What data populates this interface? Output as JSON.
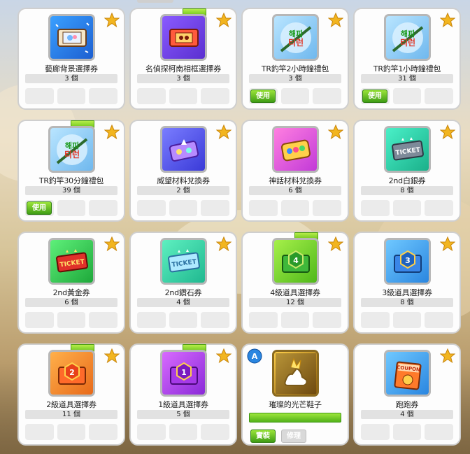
{
  "star_color": "#f2b51f",
  "use_color": "#4cae1c",
  "items": [
    {
      "name": "藝廊背景選擇券",
      "qty": "3 個",
      "icon": "ticket-photo-icon",
      "tag": false,
      "use": false
    },
    {
      "name": "名偵探柯南相框選擇券",
      "qty": "3 個",
      "icon": "ticket-frame-icon",
      "tag": true,
      "use": false
    },
    {
      "name": "TR釣竿2小時鐘禮包",
      "qty": "3 個",
      "icon": "fishing-rod-icon",
      "tag": false,
      "use": true
    },
    {
      "name": "TR釣竿1小時鐘禮包",
      "qty": "31 個",
      "icon": "fishing-rod-icon",
      "tag": false,
      "use": true
    },
    {
      "name": "TR釣竿30分鐘禮包",
      "qty": "39 個",
      "icon": "fishing-rod-icon",
      "tag": true,
      "use": true
    },
    {
      "name": "威望材料兌換券",
      "qty": "2 個",
      "icon": "material-ticket-icon",
      "tag": false,
      "use": false
    },
    {
      "name": "神話材料兌換券",
      "qty": "6 個",
      "icon": "material-ticket-icon",
      "tag": false,
      "use": false
    },
    {
      "name": "2nd白銀券",
      "qty": "8 個",
      "icon": "silver-ticket-icon",
      "tag": false,
      "use": false
    },
    {
      "name": "2nd黃金券",
      "qty": "6 個",
      "icon": "gold-ticket-icon",
      "tag": false,
      "use": false
    },
    {
      "name": "2nd鑽石券",
      "qty": "4 個",
      "icon": "diamond-ticket-icon",
      "tag": false,
      "use": false
    },
    {
      "name": "4級道具選擇券",
      "qty": "12 個",
      "icon": "level-ticket-icon",
      "tag": true,
      "use": false
    },
    {
      "name": "3級道具選擇券",
      "qty": "8 個",
      "icon": "level-ticket-icon",
      "tag": false,
      "use": false
    },
    {
      "name": "2級道具選擇券",
      "qty": "11 個",
      "icon": "level-ticket-icon",
      "tag": true,
      "use": false
    },
    {
      "name": "1級道具選擇券",
      "qty": "5 個",
      "icon": "level-ticket-icon",
      "tag": true,
      "use": false
    },
    {
      "name": "璀璨的光芒鞋子",
      "qty": "",
      "icon": "shiny-shoes-icon",
      "tag": false,
      "use": false
    },
    {
      "name": "跑跑券",
      "qty": "4 個",
      "icon": "coupon-icon",
      "tag": false,
      "use": false
    }
  ],
  "labels": {
    "use": "使用",
    "equip": "實裝",
    "repair": "修理",
    "ticket": "TICKET",
    "coupon": "COUPON",
    "rod_text": "해피",
    "level_numbers": [
      "4",
      "3",
      "2",
      "1"
    ]
  }
}
